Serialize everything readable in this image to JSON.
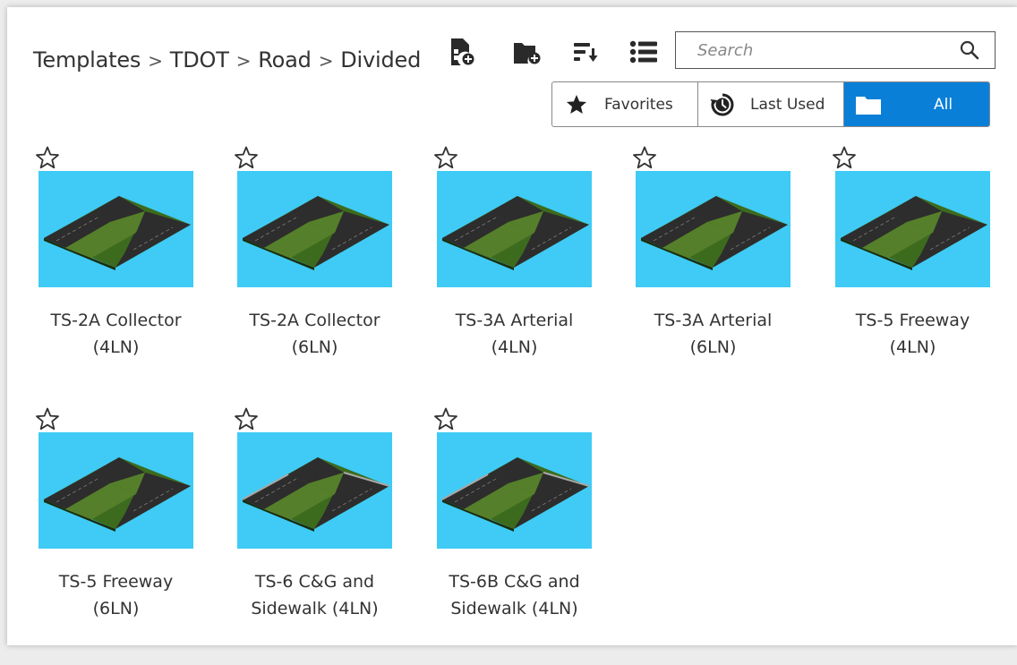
{
  "breadcrumb": {
    "items": [
      "Templates",
      "TDOT",
      "Road",
      "Divided"
    ],
    "separator": ">"
  },
  "toolbar": {
    "icons": [
      "new-template-icon",
      "new-folder-icon",
      "sort-icon",
      "list-view-icon"
    ]
  },
  "search": {
    "placeholder": "Search",
    "value": ""
  },
  "filters": {
    "favorites_label": "Favorites",
    "last_used_label": "Last Used",
    "all_label": "All",
    "active": "All",
    "active_color": "#0a7fd8"
  },
  "templates": [
    {
      "name": "TS-2A Collector\n(4LN)",
      "favorite": false,
      "variant": "plain"
    },
    {
      "name": "TS-2A Collector\n(6LN)",
      "favorite": false,
      "variant": "plain"
    },
    {
      "name": "TS-3A Arterial\n(4LN)",
      "favorite": false,
      "variant": "plain"
    },
    {
      "name": "TS-3A Arterial\n(6LN)",
      "favorite": false,
      "variant": "plain"
    },
    {
      "name": "TS-5 Freeway\n(4LN)",
      "favorite": false,
      "variant": "plain"
    },
    {
      "name": "TS-5 Freeway\n(6LN)",
      "favorite": false,
      "variant": "plain"
    },
    {
      "name": "TS-6 C&G and\nSidewalk (4LN)",
      "favorite": false,
      "variant": "curb"
    },
    {
      "name": "TS-6B C&G and\nSidewalk (4LN)",
      "favorite": false,
      "variant": "curb"
    }
  ],
  "colors": {
    "thumbnail_bg": "#3fcbf5",
    "asphalt": "#2b2b2b",
    "median": "#4e7a25"
  }
}
